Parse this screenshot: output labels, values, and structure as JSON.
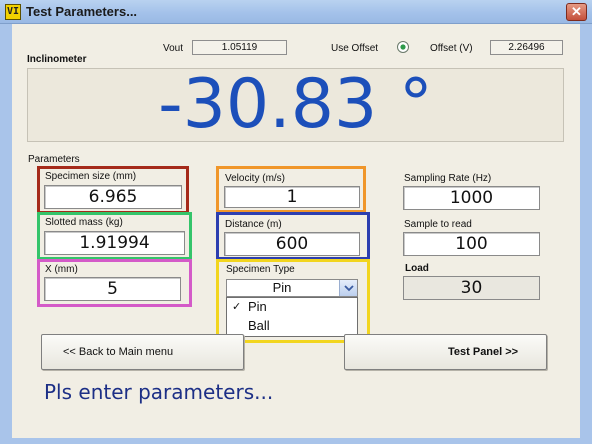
{
  "window": {
    "title": "Test Parameters...",
    "app_icon_label": "VI",
    "close_glyph": "✕"
  },
  "header": {
    "vout_label": "Vout",
    "vout_value": "1.05119",
    "use_offset_label": "Use Offset",
    "use_offset_checked": true,
    "offset_label": "Offset (V)",
    "offset_value": "2.26496"
  },
  "inclinometer": {
    "label": "Inclinometer",
    "reading": "-30.83 °"
  },
  "parameters": {
    "section_label": "Parameters",
    "specimen_size": {
      "label": "Specimen size (mm)",
      "value": "6.965"
    },
    "slotted_mass": {
      "label": "Slotted mass (kg)",
      "value": "1.91994"
    },
    "x": {
      "label": "X (mm)",
      "value": "5"
    },
    "velocity": {
      "label": "Velocity (m/s)",
      "value": "1"
    },
    "distance": {
      "label": "Distance (m)",
      "value": "600"
    },
    "specimen_type": {
      "label": "Specimen Type",
      "selected": "Pin",
      "options": [
        "Pin",
        "Ball"
      ],
      "check_glyph": "✓"
    },
    "sampling_rate": {
      "label": "Sampling Rate (Hz)",
      "value": "1000"
    },
    "sample_to_read": {
      "label": "Sample to read",
      "value": "100"
    },
    "load": {
      "label": "Load",
      "value": "30"
    }
  },
  "buttons": {
    "back": "<< Back to Main menu",
    "test_panel": "Test Panel >>"
  },
  "status": "Pls enter parameters...",
  "highlight_colors": {
    "specimen_size": "#a52a1a",
    "slotted_mass": "#34c46a",
    "x": "#d45ac8",
    "velocity": "#f0962a",
    "distance": "#2c3eb0",
    "specimen_type": "#f2d51e"
  },
  "colors": {
    "readout": "#1c4fba",
    "status": "#1c2f86",
    "titlebar": "#a4c2ea"
  }
}
